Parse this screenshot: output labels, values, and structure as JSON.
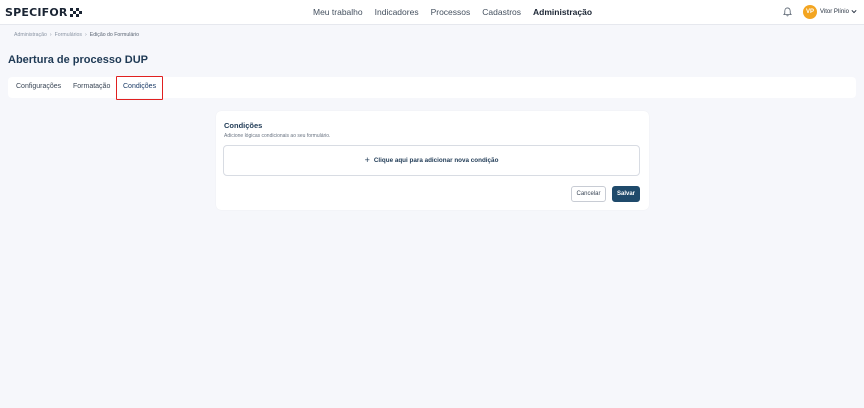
{
  "header": {
    "logo_text": "SPECIFOR",
    "nav": [
      {
        "label": "Meu trabalho"
      },
      {
        "label": "Indicadores"
      },
      {
        "label": "Processos"
      },
      {
        "label": "Cadastros"
      },
      {
        "label": "Administração",
        "active": true
      }
    ],
    "user": {
      "initials": "VP",
      "name": "Vitor Plínio"
    },
    "colors": {
      "avatar": "#f3a521"
    },
    "icons": [
      "bell-icon",
      "chevron-down-icon"
    ]
  },
  "breadcrumb": [
    "Administração",
    "Formulários",
    "Edição do Formulário"
  ],
  "page": {
    "title": "Abertura de processo DUP"
  },
  "tabs": [
    {
      "label": "Configurações"
    },
    {
      "label": "Formatação"
    },
    {
      "label": "Condições",
      "active": true
    }
  ],
  "conditions": {
    "title": "Condições",
    "subtitle": "Adicione lógicas condicionais ao seu formulário.",
    "add_label": "Clique aqui para adicionar nova condição",
    "cancel_label": "Cancelar",
    "save_label": "Salvar",
    "colors": {
      "primary": "#1f4a6b",
      "highlight": "#e02020"
    }
  }
}
